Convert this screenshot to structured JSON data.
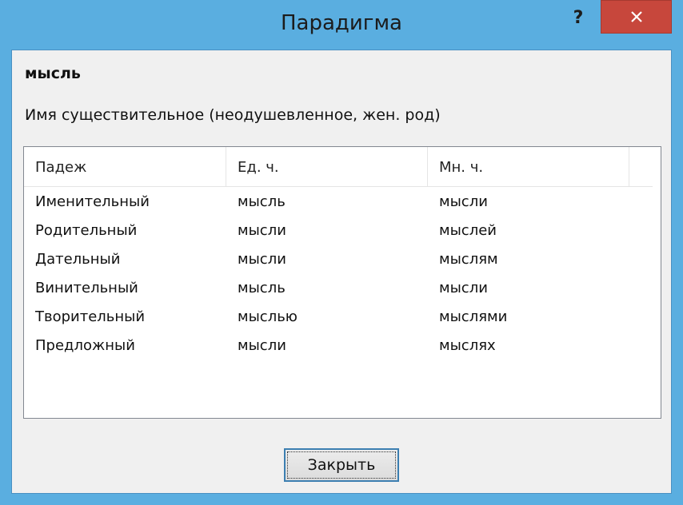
{
  "window": {
    "title": "Парадигма"
  },
  "titlebar": {
    "help_label": "?"
  },
  "entry": {
    "word": "мысль",
    "part_of_speech": "Имя существительное (неодушевленное, жен. род)"
  },
  "table": {
    "headers": [
      "Падеж",
      "Ед. ч.",
      "Мн. ч."
    ],
    "rows": [
      [
        "Именительный",
        "мысль",
        "мысли"
      ],
      [
        "Родительный",
        "мысли",
        "мыслей"
      ],
      [
        "Дательный",
        "мысли",
        "мыслям"
      ],
      [
        "Винительный",
        "мысль",
        "мысли"
      ],
      [
        "Творительный",
        "мыслью",
        "мыслями"
      ],
      [
        "Предложный",
        "мысли",
        "мыслях"
      ]
    ]
  },
  "footer": {
    "close_label": "Закрыть"
  },
  "colors": {
    "titlebar": "#5aaee0",
    "close_button": "#c7473c",
    "client": "#f0f0f0"
  }
}
